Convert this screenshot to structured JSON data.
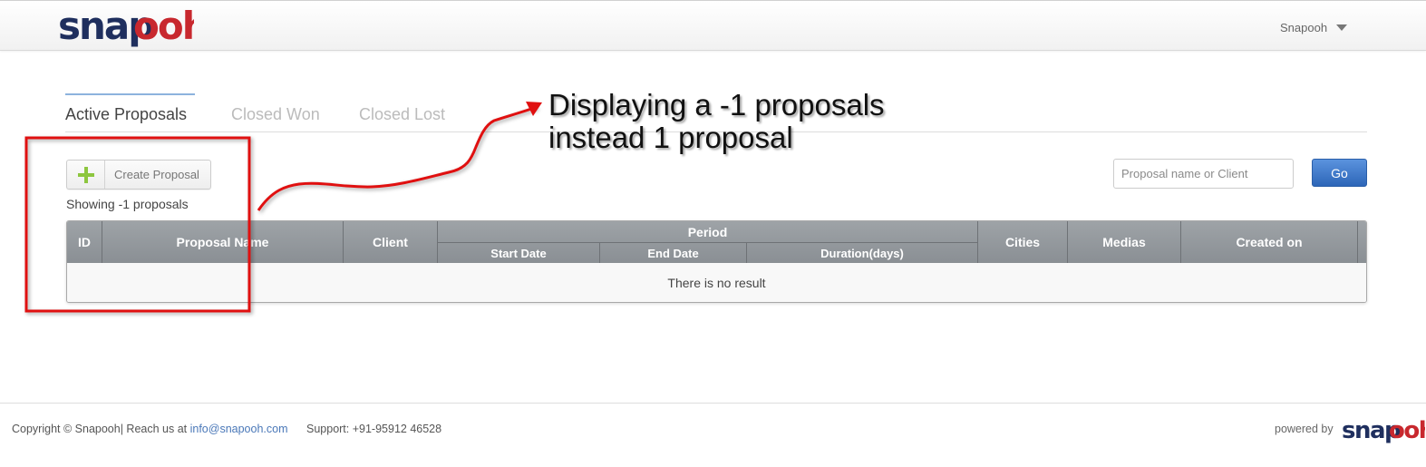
{
  "header": {
    "logo": {
      "part1": "snap",
      "part2": "ooh"
    },
    "user_name": "Snapooh"
  },
  "tabs": [
    {
      "label": "Active Proposals",
      "active": true
    },
    {
      "label": "Closed Won",
      "active": false
    },
    {
      "label": "Closed Lost",
      "active": false
    }
  ],
  "annotation": {
    "line1": "Displaying a -1 proposals",
    "line2": "instead 1 proposal"
  },
  "toolbar": {
    "create_label": "Create Proposal",
    "showing_text": "Showing -1 proposals",
    "search_placeholder": "Proposal name or Client",
    "go_label": "Go"
  },
  "table": {
    "headers": {
      "id": "ID",
      "proposal_name": "Proposal Name",
      "client": "Client",
      "period": "Period",
      "start_date": "Start Date",
      "end_date": "End Date",
      "duration": "Duration(days)",
      "cities": "Cities",
      "medias": "Medias",
      "created_on": "Created on"
    },
    "empty_message": "There is no result"
  },
  "footer": {
    "copyright_prefix": "Copyright © Snapooh| Reach us at ",
    "email": "info@snapooh.com",
    "support": "Support: +91-95912 46528",
    "powered_by": "powered by"
  },
  "colors": {
    "brand_navy": "#1f2f5e",
    "brand_red": "#c8282e",
    "annotation_red": "#e01010",
    "accent_blue": "#2d66b8",
    "plus_green": "#8dc63f"
  }
}
